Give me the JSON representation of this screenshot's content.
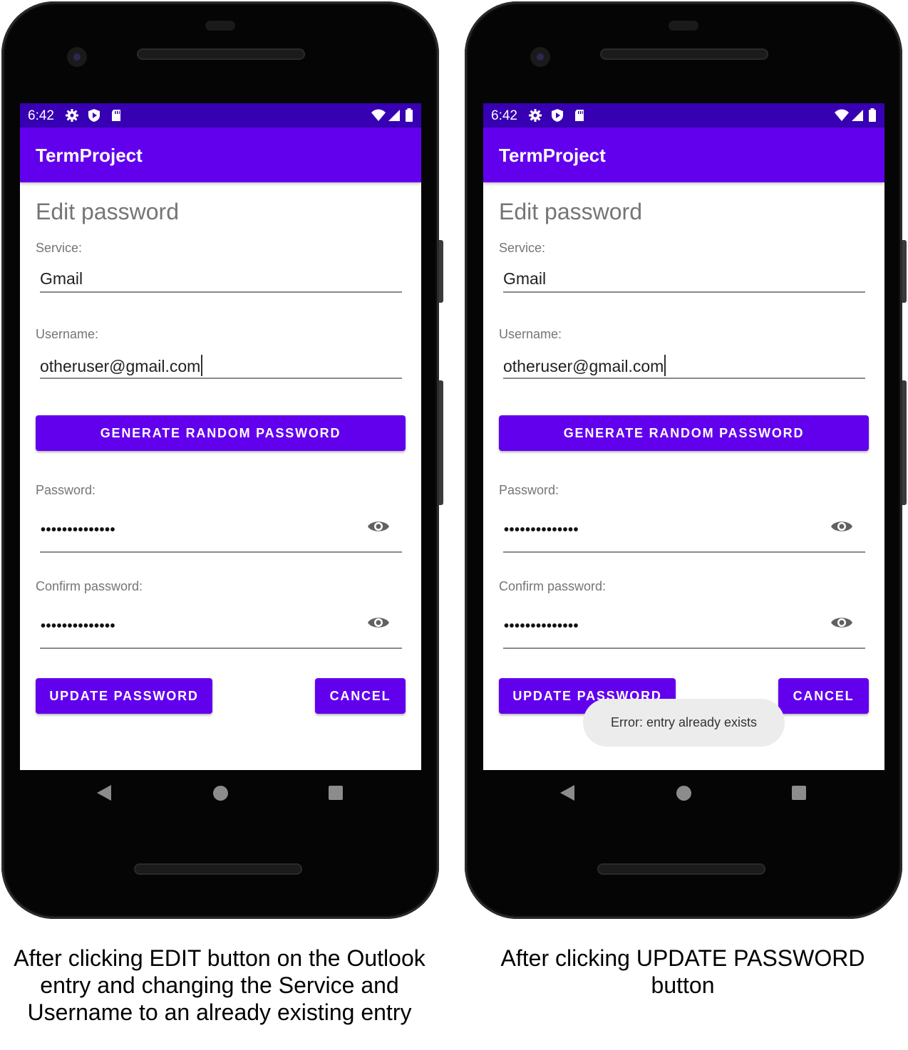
{
  "colors": {
    "primary": "#6200ee",
    "primary_dark": "#3700b3",
    "hint_gray": "#757575",
    "toast_bg": "#ececec"
  },
  "phones": [
    {
      "status_time": "6:42",
      "status_icons_left": [
        "gear-icon",
        "shield-play-icon",
        "sd-card-icon"
      ],
      "status_icons_right": [
        "wifi-icon",
        "signal-icon",
        "battery-icon"
      ],
      "app_title": "TermProject",
      "page_title": "Edit password",
      "service_label": "Service:",
      "service_value": "Gmail",
      "username_label": "Username:",
      "username_value": "otheruser@gmail.com",
      "generate_button": "GENERATE RANDOM PASSWORD",
      "password_label": "Password:",
      "password_value": "••••••••••••••",
      "confirm_label": "Confirm password:",
      "confirm_value": "••••••••••••••",
      "update_button": "UPDATE PASSWORD",
      "cancel_button": "CANCEL",
      "toast": "",
      "caption": "After clicking EDIT button on the Outlook\nentry and changing the Service and\nUsername to an already existing entry"
    },
    {
      "status_time": "6:42",
      "status_icons_left": [
        "gear-icon",
        "shield-play-icon",
        "sd-card-icon"
      ],
      "status_icons_right": [
        "wifi-icon",
        "signal-icon",
        "battery-icon"
      ],
      "app_title": "TermProject",
      "page_title": "Edit password",
      "service_label": "Service:",
      "service_value": "Gmail",
      "username_label": "Username:",
      "username_value": "otheruser@gmail.com",
      "generate_button": "GENERATE RANDOM PASSWORD",
      "password_label": "Password:",
      "password_value": "••••••••••••••",
      "confirm_label": "Confirm password:",
      "confirm_value": "••••••••••••••",
      "update_button": "UPDATE PASSWORD",
      "cancel_button": "CANCEL",
      "toast": "Error: entry already exists",
      "caption": "After clicking UPDATE PASSWORD\nbutton"
    }
  ]
}
